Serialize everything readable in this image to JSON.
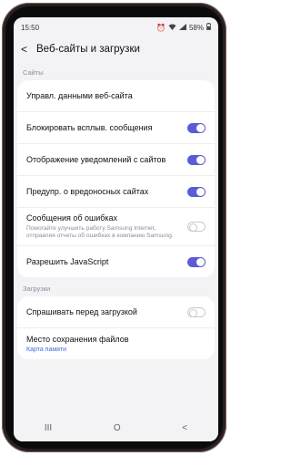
{
  "status": {
    "time": "15:50",
    "battery": "58%"
  },
  "header": {
    "title": "Веб-сайты и загрузки"
  },
  "sections": {
    "sites": {
      "title": "Сайты"
    },
    "downloads": {
      "title": "Загрузки"
    }
  },
  "rows": {
    "manage": {
      "title": "Управл. данными веб-сайта"
    },
    "popups": {
      "title": "Блокировать всплыв. сообщения",
      "on": true
    },
    "notifications": {
      "title": "Отображение уведомлений с сайтов",
      "on": true
    },
    "malicious": {
      "title": "Предупр. о вредоносных сайтах",
      "on": true
    },
    "errors": {
      "title": "Сообщения об ошибках",
      "subtitle": "Помогайте улучшить работу Samsung Internet, отправляя отчеты об ошибках в компанию Samsung.",
      "on": false
    },
    "javascript": {
      "title": "Разрешить JavaScript",
      "on": true
    },
    "ask_download": {
      "title": "Спрашивать перед загрузкой",
      "on": false
    },
    "save_location": {
      "title": "Место сохранения файлов",
      "value": "Карта памяти"
    }
  },
  "nav": {
    "recents_glyph": "III",
    "home_glyph": "O",
    "back_glyph": "<"
  },
  "colors": {
    "accent": "#5b5bd6",
    "link": "#3b6fd8"
  }
}
